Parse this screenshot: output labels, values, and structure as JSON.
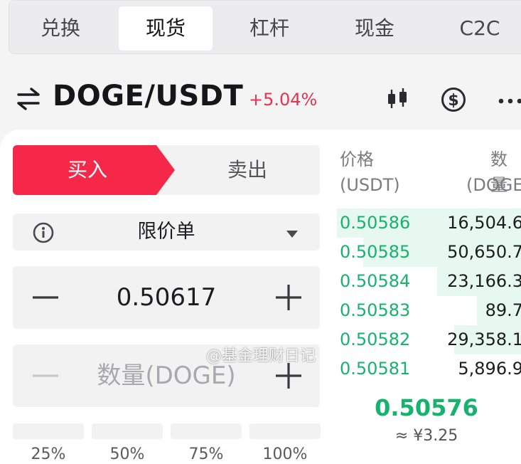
{
  "tabs": [
    {
      "label": "兑换",
      "active": false
    },
    {
      "label": "现货",
      "active": true
    },
    {
      "label": "杠杆",
      "active": false
    },
    {
      "label": "现金",
      "active": false
    },
    {
      "label": "C2C",
      "active": false
    }
  ],
  "header": {
    "pair": "DOGE/USDT",
    "change": "+5.04%",
    "change_color": "#e8334f",
    "icons": [
      "swap-arrows-icon",
      "candlestick-chart-icon",
      "dollar-coin-icon",
      "more-icon"
    ]
  },
  "order_form": {
    "buy_label": "买入",
    "sell_label": "卖出",
    "buy_color": "#f5284a",
    "order_type": "限价单",
    "price_value": "0.50617",
    "amount_placeholder": "数量(DOGE)",
    "percent_labels": [
      "25%",
      "50%",
      "75%",
      "100%"
    ]
  },
  "order_book": {
    "price_header": "价格",
    "price_unit": "(USDT)",
    "amount_header": "数量",
    "amount_unit": "(DOGE",
    "bids": [
      {
        "price": "0.50586",
        "amount": "16,504.6",
        "depth": 1.0
      },
      {
        "price": "0.50585",
        "amount": "50,650.7",
        "depth": 0.86
      },
      {
        "price": "0.50584",
        "amount": "23,166.3",
        "depth": 0.46
      },
      {
        "price": "0.50583",
        "amount": "89.7",
        "depth": 0.25
      },
      {
        "price": "0.50582",
        "amount": "29,358.1",
        "depth": 0.37
      },
      {
        "price": "0.50581",
        "amount": "5,896.9",
        "depth": 0.0
      }
    ],
    "last_price": "0.50576",
    "last_price_fiat": "≈ ¥3.25",
    "bid_color": "#16b36e"
  },
  "watermark": "@基金理财日记"
}
